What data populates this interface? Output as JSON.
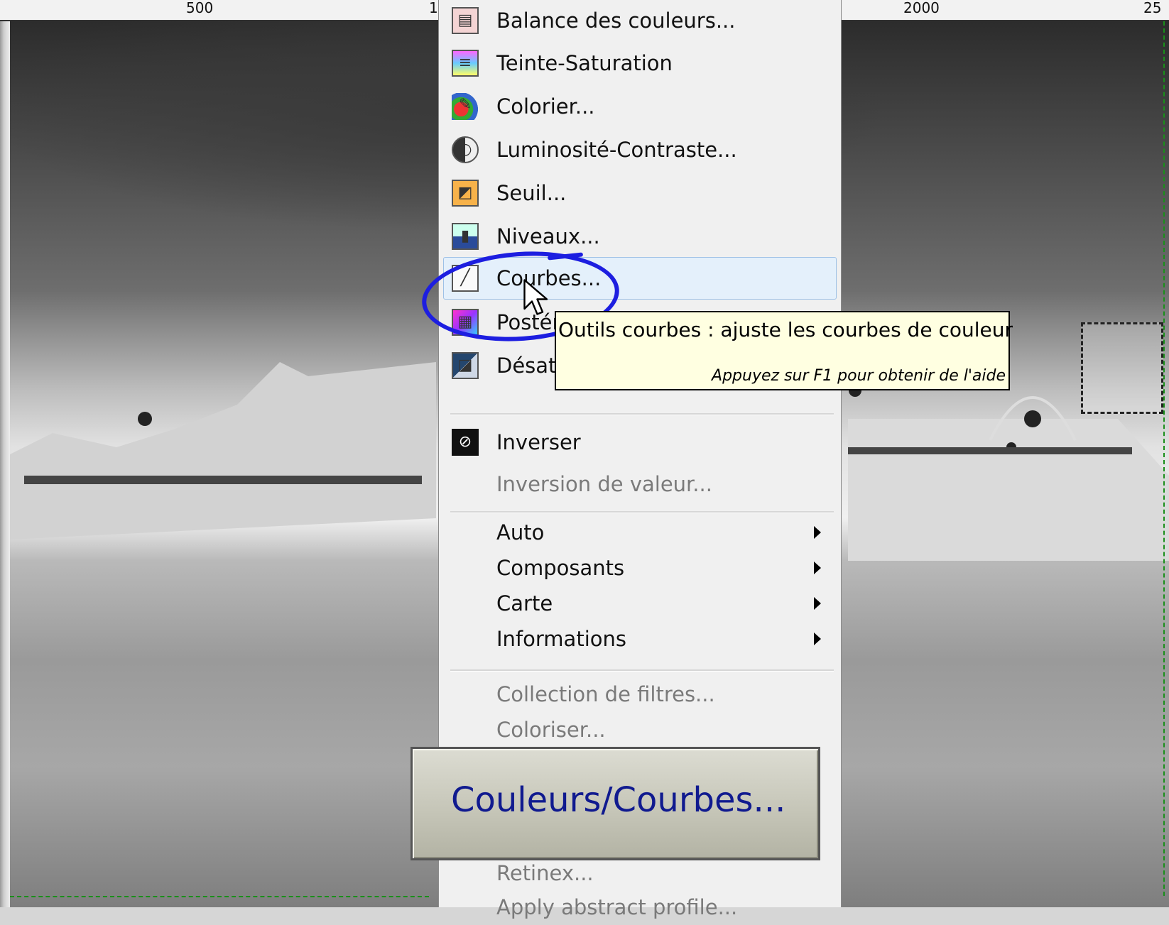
{
  "ruler": {
    "marks": [
      "500",
      "1",
      "2000",
      "25"
    ]
  },
  "menu": {
    "items": [
      {
        "label": "Balance des couleurs...",
        "icon": "color-balance-icon",
        "type": "normal"
      },
      {
        "label": "Teinte-Saturation",
        "icon": "hue-saturation-icon",
        "type": "normal"
      },
      {
        "label": "Colorier...",
        "icon": "colorize-icon",
        "type": "normal"
      },
      {
        "label": "Luminosité-Contraste...",
        "icon": "brightness-contrast-icon",
        "type": "normal"
      },
      {
        "label": "Seuil...",
        "icon": "threshold-icon",
        "type": "normal"
      },
      {
        "label": "Niveaux...",
        "icon": "levels-icon",
        "type": "normal"
      },
      {
        "label": "Courbes...",
        "icon": "curves-icon",
        "type": "highlighted"
      },
      {
        "label": "Postériser...",
        "icon": "posterize-icon",
        "type": "normal"
      },
      {
        "label": "Désaturer...",
        "icon": "desaturate-icon",
        "type": "normal"
      },
      {
        "label": "Inverser",
        "icon": "invert-icon",
        "type": "normal"
      },
      {
        "label": "Inversion de valeur...",
        "type": "disabled"
      },
      {
        "label": "Auto",
        "type": "submenu"
      },
      {
        "label": "Composants",
        "type": "submenu"
      },
      {
        "label": "Carte",
        "type": "submenu"
      },
      {
        "label": "Informations",
        "type": "submenu"
      },
      {
        "label": "Collection de filtres...",
        "type": "disabled"
      },
      {
        "label": "Coloriser...",
        "type": "disabled"
      },
      {
        "label": "Retinex...",
        "type": "disabled"
      },
      {
        "label": "Apply abstract profile...",
        "type": "disabled"
      }
    ]
  },
  "tooltip": {
    "title": "Outils courbes : ajuste les courbes de couleur",
    "hint": "Appuyez sur F1 pour obtenir de l'aide"
  },
  "caption": {
    "text": "Couleurs/Courbes..."
  },
  "colors": {
    "highlight_circle": "#1d1ee0",
    "caption_text": "#101a8f",
    "tooltip_bg": "#ffffe1"
  }
}
